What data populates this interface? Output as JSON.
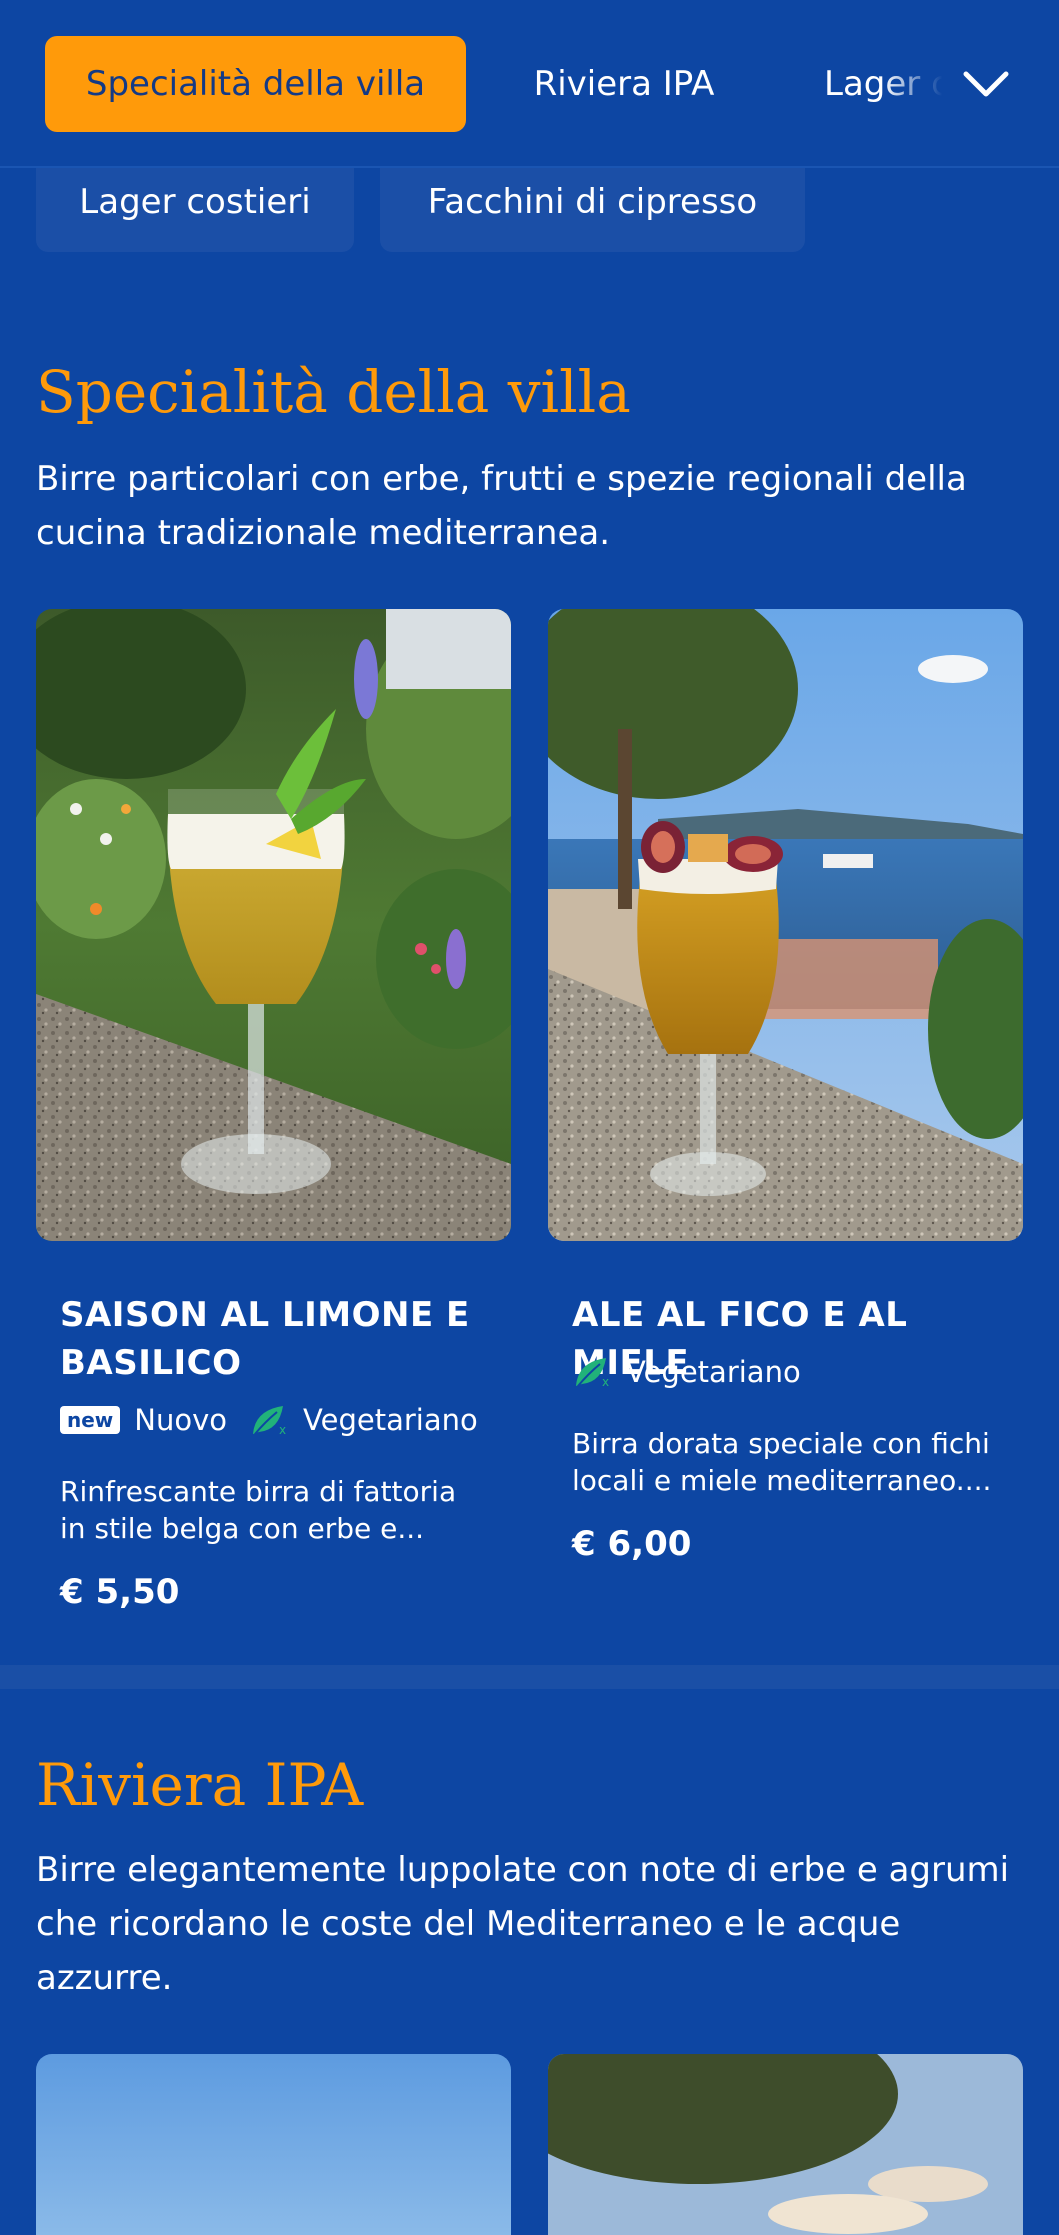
{
  "tabs": [
    {
      "label": "Specialità della villa",
      "active": true
    },
    {
      "label": "Riviera IPA",
      "active": false
    },
    {
      "label": "Lager costieri",
      "active": false
    }
  ],
  "dropdown_chips": [
    {
      "label": "Lager costieri"
    },
    {
      "label": "Facchini di cipresso"
    }
  ],
  "sections": [
    {
      "title": "Specialità della villa",
      "description": "Birre particolari con erbe, frutti e spezie regionali della cucina tradizionale mediterranea.",
      "products": [
        {
          "name": "SAISON AL LIMONE E BASILICO",
          "badge": "new",
          "new_label": "Nuovo",
          "diet_label": "Vegetariano",
          "description": "Rinfrescante birra di fattoria in stile belga con erbe e...",
          "price": "€ 5,50",
          "image_icon": "beer-glass-lemon-basil"
        },
        {
          "name": "ALE AL FICO E AL MIELE",
          "diet_label": "Vegetariano",
          "description": "Birra dorata speciale con fichi locali e miele mediterraneo....",
          "price": "€ 6,00",
          "image_icon": "beer-glass-fig-sea-view"
        }
      ]
    },
    {
      "title": "Riviera IPA",
      "description": "Birre elegantemente luppolate con note di erbe e agrumi che ricordano le coste del Mediterraneo e le acque azzurre."
    }
  ],
  "colors": {
    "background": "#0d46a3",
    "accent": "#ff9a0a",
    "vegetarian_icon": "#21b27a"
  }
}
